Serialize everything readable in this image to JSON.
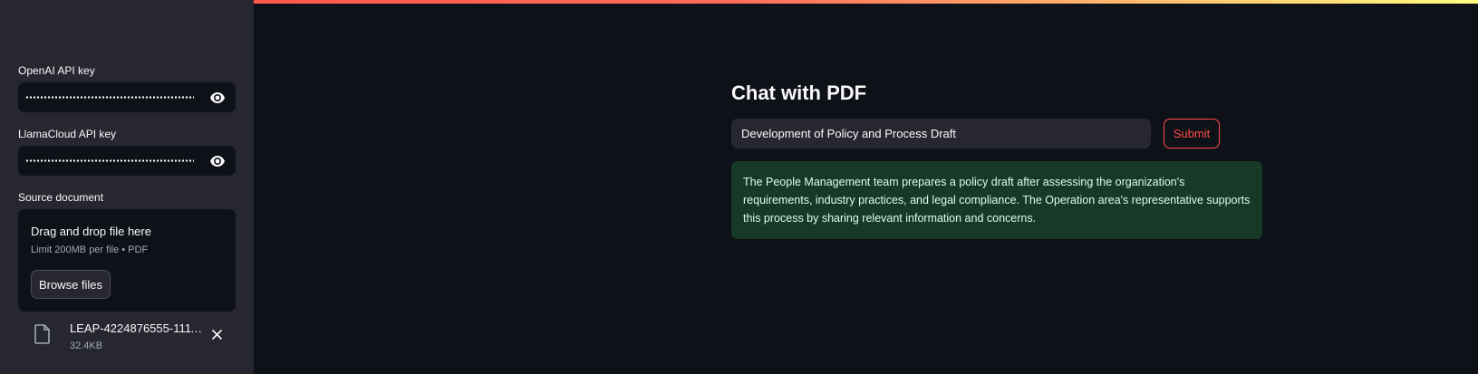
{
  "sidebar": {
    "openai_label": "OpenAI API key",
    "llamacloud_label": "LlamaCloud API key",
    "source_label": "Source document",
    "uploader": {
      "title": "Drag and drop file here",
      "subtitle": "Limit 200MB per file • PDF",
      "browse_label": "Browse files"
    },
    "file": {
      "name": "LEAP-4224876555-11112...",
      "size": "32.4KB"
    }
  },
  "main": {
    "title": "Chat with PDF",
    "query_value": "Development of Policy and Process Draft",
    "submit_label": "Submit",
    "answer": "The People Management team prepares a policy draft after assessing the organization's requirements, industry practices, and legal compliance. The Operation area's representative supports this process by sharing relevant information and concerns."
  },
  "icons": {
    "eye": "eye-icon",
    "file": "file-icon",
    "close": "close-icon"
  },
  "colors": {
    "accent": "#ff4b4b",
    "background": "#0e1117",
    "sidebar": "#262730",
    "success_bg": "#173928"
  }
}
